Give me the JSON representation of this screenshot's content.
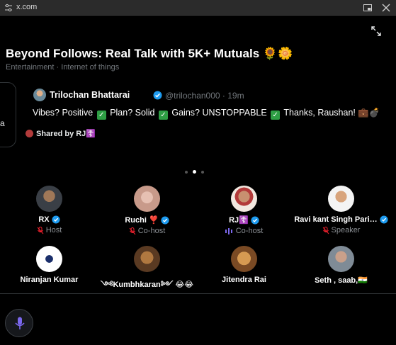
{
  "window": {
    "domain": "x.com"
  },
  "space": {
    "title": "Beyond Follows: Real Talk with 5K+ Mutuals 🌻🌼",
    "topics": "Entertainment · Internet of things"
  },
  "prev_card_text": "a",
  "post": {
    "name": "Trilochan Bhattarai",
    "handle": "@trilochan000 · 19m",
    "text_parts": [
      "Vibes? Positive ",
      " Plan? Solid ",
      " Gains? UNSTOPPABLE ",
      " Thanks, Raushan! 💼💣"
    ],
    "check_glyph": "✓"
  },
  "shared_by": "Shared by RJ☦️",
  "speakers": [
    {
      "name": "RX",
      "role": "Host"
    },
    {
      "name": "Ruchi ❣️",
      "role": "Co-host"
    },
    {
      "name": "RJ☦️",
      "role": "Co-host"
    },
    {
      "name": "Ravi kant Singh Pari…",
      "role": "Speaker"
    },
    {
      "name": "Niranjan Kumar",
      "role": ""
    },
    {
      "name": "༺Kumbhkaran༻ 😂😂",
      "role": ""
    },
    {
      "name": "Jitendra Rai",
      "role": ""
    },
    {
      "name": "Seth , saab,🇮🇳",
      "role": ""
    }
  ],
  "colors": {
    "verified": "#1d9bf0",
    "check": "#2e9e44",
    "mic": "#7b68ee",
    "muted": "#f4212e"
  },
  "icons": {
    "mic": "microphone-icon",
    "muted": "mic-off-icon",
    "verified": "verified-badge-icon"
  }
}
